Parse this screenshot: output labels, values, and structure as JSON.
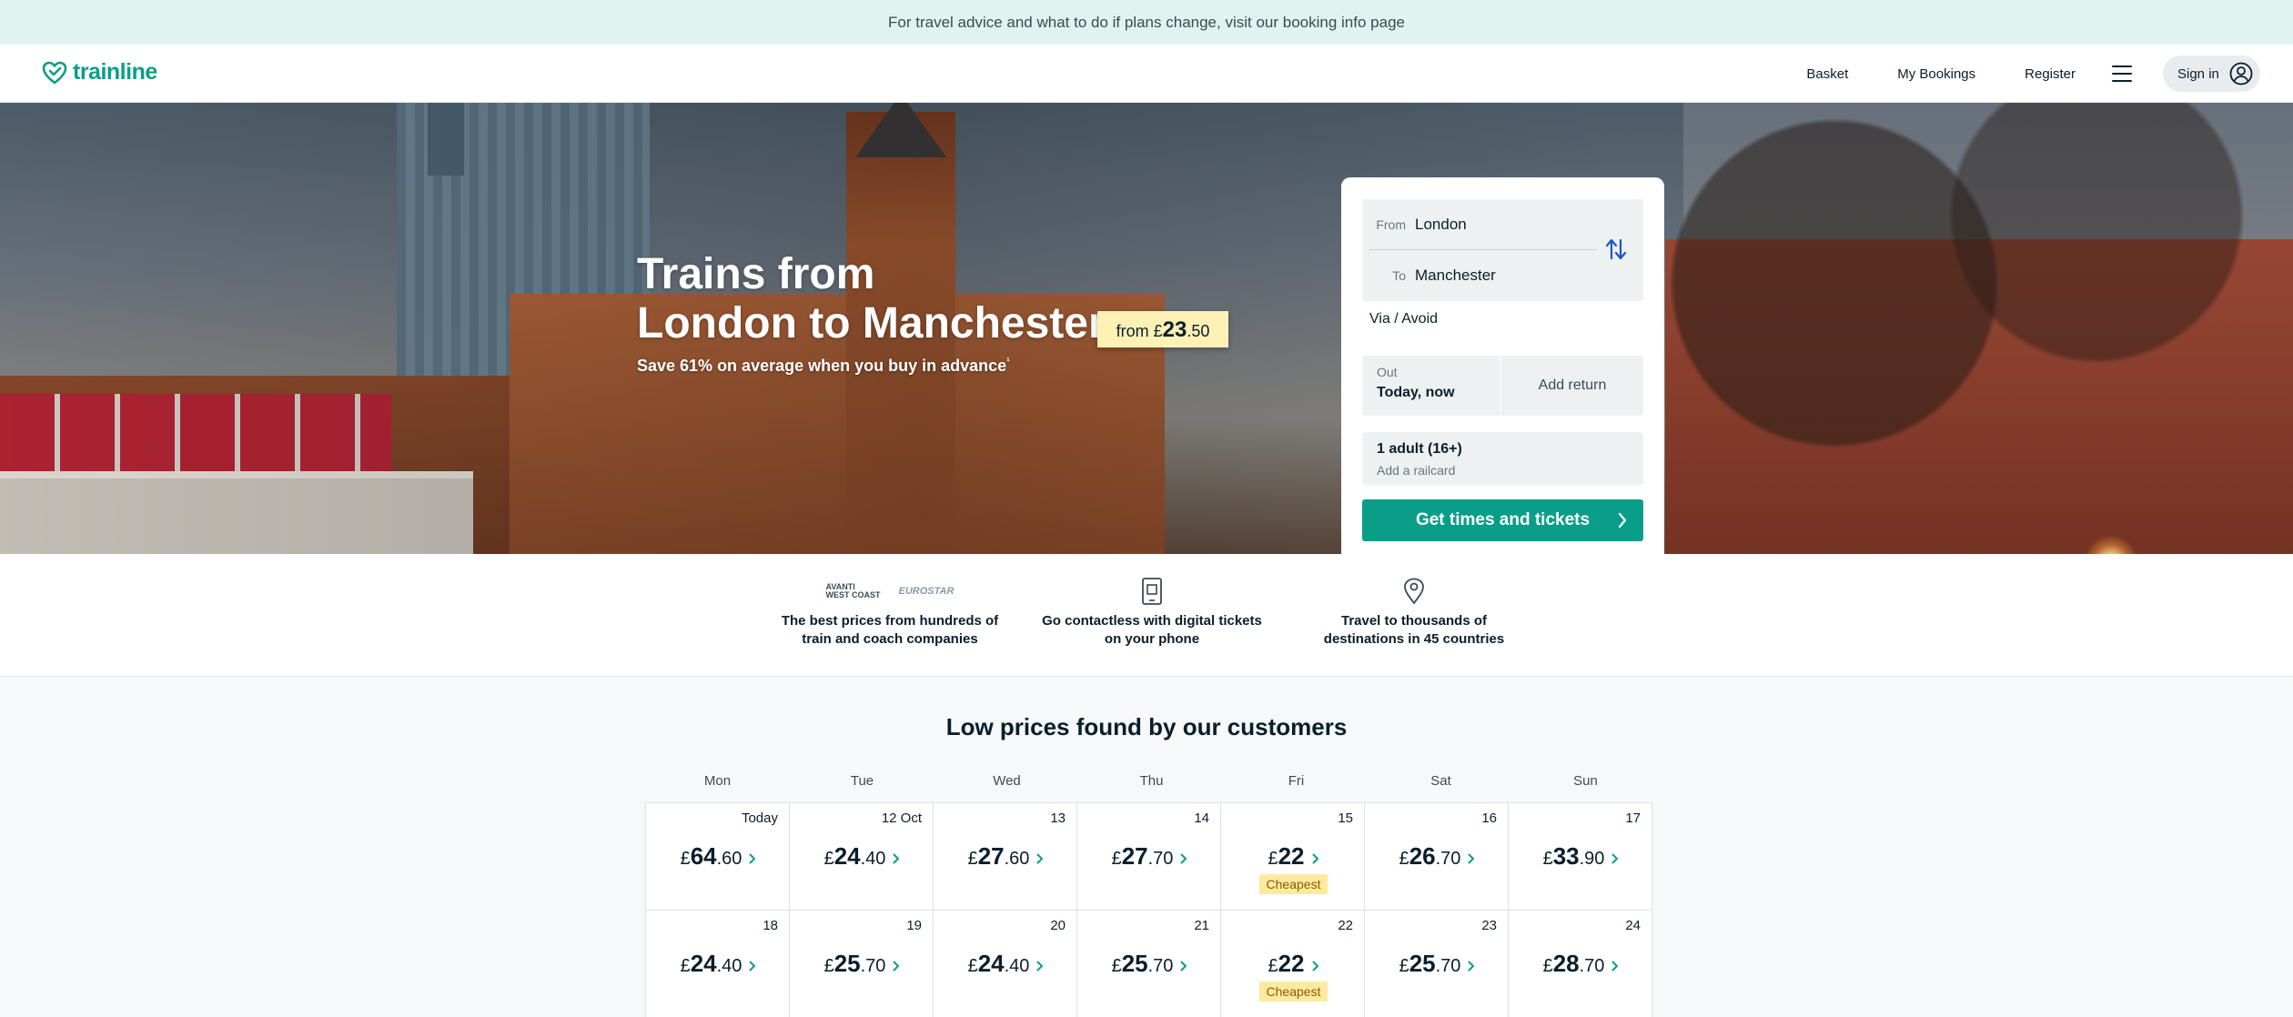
{
  "banner": {
    "text": "For travel advice and what to do if plans change, visit our booking info page"
  },
  "header": {
    "logo": "trainline",
    "nav": [
      "Basket",
      "My Bookings",
      "Register"
    ],
    "signin": "Sign in"
  },
  "hero": {
    "title_line1": "Trains from",
    "title_line2": "London to Manchester",
    "price_prefix": "from",
    "price_currency": "£",
    "price_main": "23",
    "price_decimals": ".50",
    "subtitle": "Save 61% on average when you buy in advance",
    "subtitle_mark": "¹"
  },
  "search": {
    "from_label": "From",
    "from_value": "London",
    "to_label": "To",
    "to_value": "Manchester",
    "via_label": "Via / Avoid",
    "out_label": "Out",
    "out_value": "Today, now",
    "return_label": "Add return",
    "passengers": "1 adult (16+)",
    "railcard": "Add a railcard",
    "cta": "Get times and tickets"
  },
  "features": [
    {
      "text1": "The best prices from hundreds of",
      "text2": "train and coach companies",
      "brand1": "AVANTI WEST COAST",
      "brand2": "EUROSTAR"
    },
    {
      "text1": "Go contactless with digital tickets",
      "text2": "on your phone"
    },
    {
      "text1": "Travel to thousands of",
      "text2": "destinations in 45 countries"
    }
  ],
  "prices": {
    "title": "Low prices found by our customers",
    "days": [
      "Mon",
      "Tue",
      "Wed",
      "Thu",
      "Fri",
      "Sat",
      "Sun"
    ],
    "cheapest_label": "Cheapest",
    "weeks": [
      [
        {
          "date": "Today",
          "main": "64",
          "dec": ".60"
        },
        {
          "date": "12 Oct",
          "main": "24",
          "dec": ".40"
        },
        {
          "date": "13",
          "main": "27",
          "dec": ".60"
        },
        {
          "date": "14",
          "main": "27",
          "dec": ".70"
        },
        {
          "date": "15",
          "main": "22",
          "dec": "",
          "cheapest": true
        },
        {
          "date": "16",
          "main": "26",
          "dec": ".70"
        },
        {
          "date": "17",
          "main": "33",
          "dec": ".90"
        }
      ],
      [
        {
          "date": "18",
          "main": "24",
          "dec": ".40"
        },
        {
          "date": "19",
          "main": "25",
          "dec": ".70"
        },
        {
          "date": "20",
          "main": "24",
          "dec": ".40"
        },
        {
          "date": "21",
          "main": "25",
          "dec": ".70"
        },
        {
          "date": "22",
          "main": "22",
          "dec": "",
          "cheapest": true
        },
        {
          "date": "23",
          "main": "25",
          "dec": ".70"
        },
        {
          "date": "24",
          "main": "28",
          "dec": ".70"
        }
      ]
    ]
  },
  "colors": {
    "brand": "#0a9e88",
    "banner_bg": "#e1f3ee",
    "price_tag_bg": "#fdf1b6",
    "cheapest_bg": "#fdeaa0"
  }
}
